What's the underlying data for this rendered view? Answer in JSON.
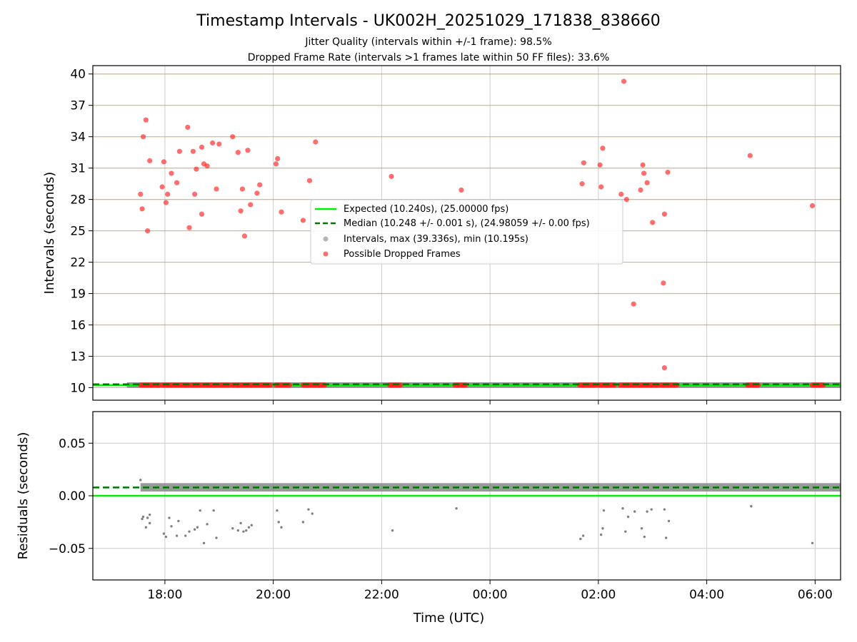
{
  "title": "Timestamp Intervals - UK002H_20251029_171838_838660",
  "subtitle_lines": [
    "Jitter Quality (intervals within +/-1 frame): 98.5%",
    "Dropped Frame Rate (intervals >1 frames late within 50 FF files): 33.6%"
  ],
  "colors": {
    "expected": "#00ee00",
    "median": "#007700",
    "intervals": "#808080",
    "dropped": "#ff2020",
    "ygrid_top": "#c8a050",
    "grid": "#cccccc"
  },
  "chart_data": [
    {
      "type": "scatter",
      "xlabel": "",
      "ylabel": "Intervals (seconds)",
      "x_unit": "hours since 00:00 UTC of 2025-10-29 (values > 24 are the next day)",
      "xlim": [
        16.67,
        30.47
      ],
      "ylim": [
        8.8,
        40.8
      ],
      "yticks": [
        10,
        13,
        16,
        19,
        22,
        25,
        28,
        31,
        34,
        37,
        40
      ],
      "grid": true,
      "legend_position": "center",
      "legend": [
        {
          "key": "expected",
          "label": "Expected (10.240s), (25.00000 fps)"
        },
        {
          "key": "median",
          "label": "Median (10.248 +/- 0.001 s), (24.98059 +/- 0.00 fps)"
        },
        {
          "key": "intervals",
          "label": "Intervals, max (39.336s), min (10.195s)"
        },
        {
          "key": "dropped",
          "label": "Possible Dropped Frames"
        }
      ],
      "expected_value": 10.24,
      "median_value": 10.248,
      "intervals_band": {
        "x_start": 17.3,
        "x_end": 30.47,
        "y_min": 10.195,
        "y_max": 10.3
      },
      "dropped_clusters": [
        [
          17.55,
          17.9
        ],
        [
          17.95,
          18.45
        ],
        [
          18.5,
          19.2
        ],
        [
          19.25,
          19.95
        ],
        [
          20.05,
          20.3
        ],
        [
          20.55,
          20.95
        ],
        [
          22.15,
          22.35
        ],
        [
          23.35,
          23.55
        ],
        [
          25.65,
          25.95
        ],
        [
          26.0,
          26.3
        ],
        [
          26.4,
          27.1
        ],
        [
          27.15,
          27.45
        ],
        [
          28.75,
          28.95
        ],
        [
          29.95,
          30.15
        ]
      ],
      "dropped_points": [
        [
          17.55,
          28.5
        ],
        [
          17.58,
          27.1
        ],
        [
          17.6,
          34.0
        ],
        [
          17.65,
          35.6
        ],
        [
          17.68,
          25.0
        ],
        [
          17.72,
          31.7
        ],
        [
          17.95,
          29.2
        ],
        [
          17.98,
          31.6
        ],
        [
          18.02,
          27.7
        ],
        [
          18.05,
          28.5
        ],
        [
          18.12,
          30.5
        ],
        [
          18.22,
          29.6
        ],
        [
          18.27,
          32.6
        ],
        [
          18.42,
          34.9
        ],
        [
          18.45,
          25.3
        ],
        [
          18.52,
          32.6
        ],
        [
          18.55,
          28.5
        ],
        [
          18.58,
          30.9
        ],
        [
          18.68,
          33.0
        ],
        [
          18.68,
          26.6
        ],
        [
          18.72,
          31.4
        ],
        [
          18.78,
          31.2
        ],
        [
          18.88,
          33.4
        ],
        [
          18.95,
          29.0
        ],
        [
          19.0,
          33.3
        ],
        [
          19.25,
          34.0
        ],
        [
          19.35,
          32.5
        ],
        [
          19.4,
          26.9
        ],
        [
          19.43,
          29.0
        ],
        [
          19.47,
          24.5
        ],
        [
          19.53,
          32.7
        ],
        [
          19.58,
          27.5
        ],
        [
          19.7,
          28.6
        ],
        [
          19.75,
          29.4
        ],
        [
          20.05,
          31.4
        ],
        [
          20.08,
          31.9
        ],
        [
          20.15,
          26.8
        ],
        [
          20.55,
          26.0
        ],
        [
          20.67,
          29.8
        ],
        [
          20.78,
          33.5
        ],
        [
          22.18,
          30.2
        ],
        [
          23.47,
          28.9
        ],
        [
          25.7,
          29.5
        ],
        [
          25.73,
          31.5
        ],
        [
          26.03,
          31.3
        ],
        [
          26.05,
          29.2
        ],
        [
          26.08,
          32.9
        ],
        [
          26.42,
          28.5
        ],
        [
          26.47,
          39.3
        ],
        [
          26.52,
          28.0
        ],
        [
          26.65,
          18.0
        ],
        [
          26.78,
          28.9
        ],
        [
          26.82,
          31.3
        ],
        [
          26.84,
          30.5
        ],
        [
          26.9,
          29.6
        ],
        [
          27.0,
          25.8
        ],
        [
          27.2,
          20.0
        ],
        [
          27.22,
          26.6
        ],
        [
          27.22,
          11.9
        ],
        [
          27.28,
          30.6
        ],
        [
          28.8,
          32.2
        ],
        [
          29.95,
          27.4
        ]
      ]
    },
    {
      "type": "scatter",
      "xlabel": "Time (UTC)",
      "ylabel": "Residuals (seconds)",
      "x_unit": "hours since 00:00 UTC of 2025-10-29 (values > 24 are the next day)",
      "xlim": [
        16.67,
        30.47
      ],
      "ylim": [
        -0.08,
        0.08
      ],
      "yticks": [
        0.05,
        0.0,
        -0.05
      ],
      "ytick_labels": [
        "0.05",
        "0.00",
        "−0.05"
      ],
      "xticks": [
        18,
        20,
        22,
        24,
        26,
        28,
        30
      ],
      "xtick_labels": [
        "18:00",
        "20:00",
        "22:00",
        "00:00",
        "02:00",
        "04:00",
        "06:00"
      ],
      "grid": true,
      "expected_value": 0.0,
      "median_value": 0.0079,
      "residuals_band": {
        "x_start": 17.55,
        "x_end": 30.47,
        "y_min": 0.004,
        "y_max": 0.012
      },
      "residual_outliers": [
        [
          17.55,
          0.015
        ],
        [
          17.58,
          -0.022
        ],
        [
          17.6,
          -0.02
        ],
        [
          17.65,
          -0.03
        ],
        [
          17.68,
          -0.021
        ],
        [
          17.72,
          -0.026
        ],
        [
          17.72,
          -0.018
        ],
        [
          17.98,
          -0.036
        ],
        [
          18.02,
          -0.039
        ],
        [
          18.08,
          -0.021
        ],
        [
          18.12,
          -0.029
        ],
        [
          18.22,
          -0.038
        ],
        [
          18.25,
          -0.024
        ],
        [
          18.38,
          -0.038
        ],
        [
          18.45,
          -0.034
        ],
        [
          18.55,
          -0.032
        ],
        [
          18.6,
          -0.03
        ],
        [
          18.65,
          -0.014
        ],
        [
          18.72,
          -0.045
        ],
        [
          18.78,
          -0.027
        ],
        [
          18.9,
          -0.014
        ],
        [
          18.95,
          -0.04
        ],
        [
          19.25,
          -0.031
        ],
        [
          19.35,
          -0.033
        ],
        [
          19.4,
          -0.026
        ],
        [
          19.45,
          -0.034
        ],
        [
          19.5,
          -0.033
        ],
        [
          19.55,
          -0.03
        ],
        [
          19.6,
          -0.028
        ],
        [
          20.07,
          -0.014
        ],
        [
          20.1,
          -0.025
        ],
        [
          20.15,
          -0.03
        ],
        [
          20.55,
          -0.025
        ],
        [
          20.65,
          -0.013
        ],
        [
          20.72,
          -0.017
        ],
        [
          22.2,
          -0.033
        ],
        [
          23.38,
          -0.012
        ],
        [
          25.67,
          -0.041
        ],
        [
          25.72,
          -0.038
        ],
        [
          26.05,
          -0.037
        ],
        [
          26.08,
          -0.031
        ],
        [
          26.1,
          -0.014
        ],
        [
          26.45,
          -0.012
        ],
        [
          26.5,
          -0.034
        ],
        [
          26.55,
          -0.02
        ],
        [
          26.67,
          -0.015
        ],
        [
          26.8,
          -0.031
        ],
        [
          26.85,
          -0.039
        ],
        [
          26.9,
          -0.015
        ],
        [
          26.98,
          -0.013
        ],
        [
          27.22,
          -0.013
        ],
        [
          27.25,
          -0.04
        ],
        [
          27.3,
          -0.024
        ],
        [
          28.82,
          -0.01
        ],
        [
          29.95,
          -0.045
        ]
      ]
    }
  ]
}
